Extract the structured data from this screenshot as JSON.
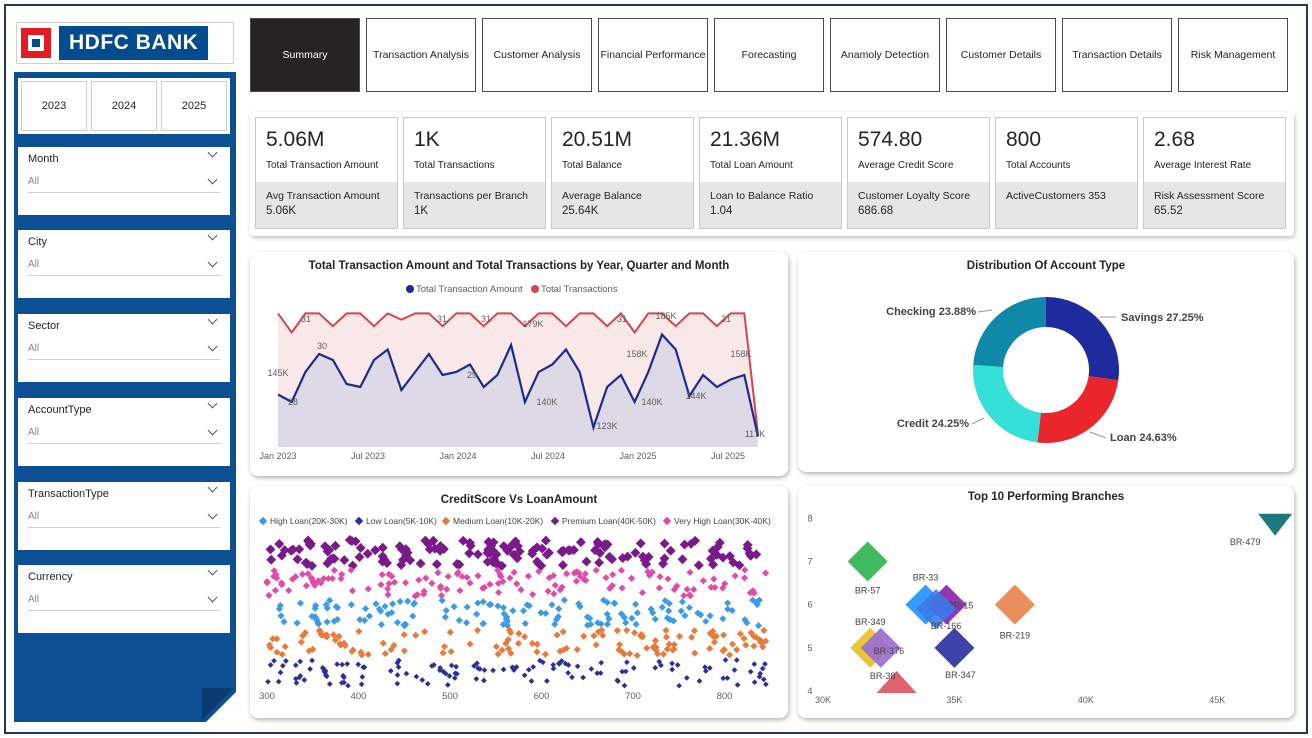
{
  "brand": {
    "name": "HDFC BANK"
  },
  "years": [
    "2023",
    "2024",
    "2025"
  ],
  "slicers": [
    {
      "label": "Month",
      "value": "All"
    },
    {
      "label": "City",
      "value": "All"
    },
    {
      "label": "Sector",
      "value": "All"
    },
    {
      "label": "AccountType",
      "value": "All"
    },
    {
      "label": "TransactionType",
      "value": "All"
    },
    {
      "label": "Currency",
      "value": "All"
    }
  ],
  "tabs": [
    "Summary",
    "Transaction Analysis",
    "Customer Analysis",
    "Financial Performance",
    "Forecasting",
    "Anamoly Detection",
    "Customer Details",
    "Transaction Details",
    "Risk Management"
  ],
  "kpis": [
    {
      "value": "5.06M",
      "label": "Total Transaction Amount",
      "sub_label": "Avg Transaction Amount",
      "sub_value": "5.06K"
    },
    {
      "value": "1K",
      "label": "Total Transactions",
      "sub_label": "Transactions per Branch",
      "sub_value": "1K"
    },
    {
      "value": "20.51M",
      "label": "Total Balance",
      "sub_label": "Average Balance",
      "sub_value": "25.64K"
    },
    {
      "value": "21.36M",
      "label": "Total Loan Amount",
      "sub_label": "Loan to Balance Ratio",
      "sub_value": "1.04"
    },
    {
      "value": "574.80",
      "label": "Average Credit Score",
      "sub_label": "Customer Loyalty Score",
      "sub_value": "686.68"
    },
    {
      "value": "800",
      "label": "Total Accounts",
      "sub_label": "ActiveCustomers 353",
      "sub_value": ""
    },
    {
      "value": "2.68",
      "label": "Average Interest Rate",
      "sub_label": "Risk Assessment Score",
      "sub_value": "65.52"
    }
  ],
  "colors": {
    "sidebar": "#0d4f93",
    "active_tab": "#252423",
    "navy": "#1f2a8f",
    "red": "#d64550"
  },
  "chart_data": [
    {
      "type": "line",
      "title": "Total Transaction Amount and Total Transactions by Year, Quarter and Month",
      "x_ticks": [
        "Jan 2023",
        "Jul 2023",
        "Jan 2024",
        "Jul 2024",
        "Jan 2025",
        "Jul 2025"
      ],
      "series": [
        {
          "name": "Total Transaction Amount",
          "color": "#1f2a8f",
          "values": [
            145,
            140,
            160,
            172,
            168,
            152,
            150,
            168,
            175,
            148,
            160,
            172,
            158,
            160,
            165,
            150,
            158,
            178,
            140,
            160,
            165,
            175,
            160,
            123,
            150,
            158,
            140,
            160,
            185,
            175,
            144,
            158,
            150,
            155,
            158,
            117
          ]
        },
        {
          "name": "Total Transactions",
          "color": "#d64550",
          "values": [
            31,
            28,
            31,
            31,
            29,
            31,
            31,
            29,
            31,
            30,
            31,
            31,
            29,
            31,
            31,
            29,
            31,
            31,
            29,
            31,
            31,
            29,
            31,
            31,
            29,
            31,
            28,
            31,
            31,
            29,
            31,
            31,
            29,
            31,
            31,
            12
          ]
        }
      ],
      "data_labels": [
        "145K",
        "28",
        "31",
        "30",
        "31",
        "29",
        "31",
        "179K",
        "140K",
        "123K",
        "31",
        "158K",
        "140K",
        "185K",
        "144K",
        "31",
        "158K",
        "117K"
      ]
    },
    {
      "type": "pie",
      "title": "Distribution Of Account Type",
      "slices": [
        {
          "label": "Savings",
          "value": 27.25,
          "display": "Savings 27.25%",
          "color": "#1f2a9c"
        },
        {
          "label": "Loan",
          "value": 24.63,
          "display": "Loan 24.63%",
          "color": "#e8262c"
        },
        {
          "label": "Credit",
          "value": 24.25,
          "display": "Credit 24.25%",
          "color": "#35e0d8"
        },
        {
          "label": "Checking",
          "value": 23.88,
          "display": "Checking 23.88%",
          "color": "#1089a8"
        }
      ]
    },
    {
      "type": "scatter",
      "title": "CreditScore Vs LoanAmount",
      "x_ticks": [
        "300",
        "400",
        "500",
        "600",
        "700",
        "800"
      ],
      "xlim": [
        300,
        850
      ],
      "series": [
        {
          "name": "High Loan(20K-30K)",
          "color": "#3b9be8",
          "band": [
            20000,
            30000
          ]
        },
        {
          "name": "Low Loan(5K-10K)",
          "color": "#2a2f9a",
          "band": [
            5000,
            10000
          ]
        },
        {
          "name": "Medium Loan(10K-20K)",
          "color": "#e97a3b",
          "band": [
            10000,
            20000
          ]
        },
        {
          "name": "Premium Loan(40K-50K)",
          "color": "#7a1a8a",
          "band": [
            40000,
            50000
          ]
        },
        {
          "name": "Very High Loan(30K-40K)",
          "color": "#e04aa8",
          "band": [
            30000,
            40000
          ]
        }
      ]
    },
    {
      "type": "scatter",
      "title": "Top 10 Performing Branches",
      "x_ticks": [
        "30K",
        "35K",
        "40K",
        "45K"
      ],
      "y_ticks": [
        "4",
        "5",
        "6",
        "7",
        "8"
      ],
      "xlim": [
        30000,
        47500
      ],
      "ylim": [
        4,
        8.4
      ],
      "points": [
        {
          "label": "BR-479",
          "x": 47200,
          "y": 7.85,
          "color": "#1e7a7a",
          "shape": "triangle-down"
        },
        {
          "label": "BR-57",
          "x": 31700,
          "y": 7.0,
          "color": "#2bb24c",
          "shape": "diamond"
        },
        {
          "label": "BR-33",
          "x": 33900,
          "y": 6.0,
          "color": "#1e90ff",
          "shape": "diamond"
        },
        {
          "label": "BR-15",
          "x": 34700,
          "y": 6.0,
          "color": "#8a1fb0",
          "shape": "diamond"
        },
        {
          "label": "BR-166",
          "x": 34300,
          "y": 5.9,
          "color": "#3a7be8",
          "shape": "diamond"
        },
        {
          "label": "BR-219",
          "x": 37300,
          "y": 6.0,
          "color": "#e8824a",
          "shape": "diamond"
        },
        {
          "label": "BR-349",
          "x": 31800,
          "y": 5.0,
          "color": "#e8c020",
          "shape": "diamond"
        },
        {
          "label": "BR-376",
          "x": 32200,
          "y": 5.0,
          "color": "#9a6ad0",
          "shape": "diamond"
        },
        {
          "label": "BR-347",
          "x": 35000,
          "y": 5.0,
          "color": "#2a2fa0",
          "shape": "diamond"
        },
        {
          "label": "BR-38",
          "x": 32800,
          "y": 4.0,
          "color": "#e06470",
          "shape": "triangle-up"
        }
      ]
    }
  ]
}
